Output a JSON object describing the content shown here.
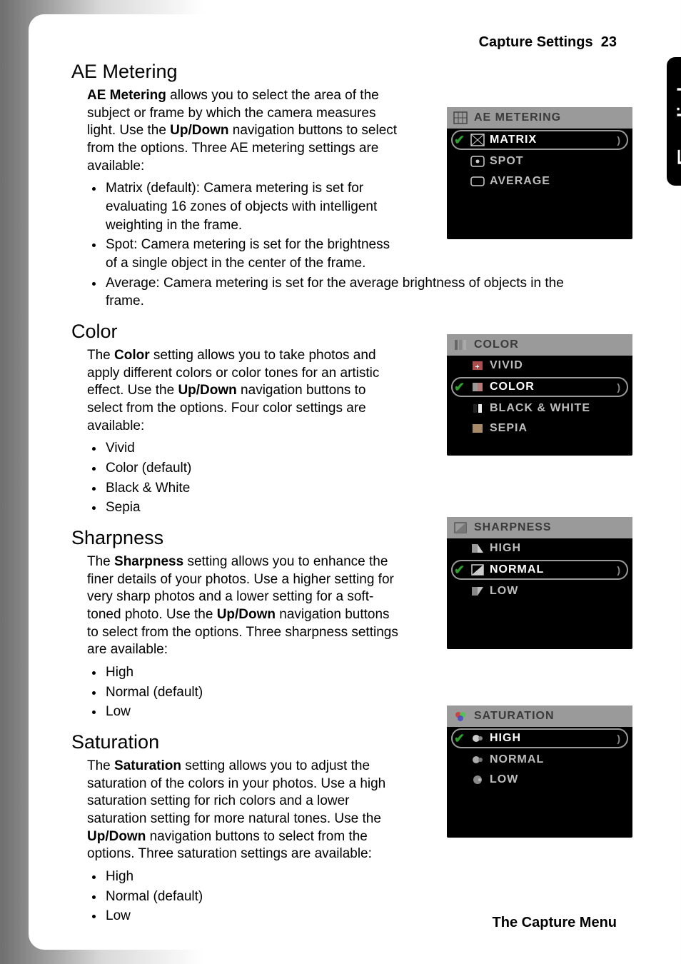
{
  "header": {
    "section": "Capture Settings",
    "page": "23"
  },
  "language_tab": "English",
  "footer": "The Capture Menu",
  "sections": {
    "ae": {
      "title": "AE Metering",
      "intro_1": "AE Metering",
      "intro_2": " allows you to select the area of the subject or frame by which the camera measures light. Use the ",
      "intro_3": "Up/Down",
      "intro_4": " navigation buttons to select from the options. Three AE metering settings are available:",
      "bullets": [
        "Matrix (default): Camera metering is set for evaluating 16 zones of objects with intelligent weighting in the frame.",
        "Spot: Camera metering is set for the brightness of a single object in the center of the frame.",
        "Average: Camera metering is set for the average brightness of objects in the frame."
      ],
      "menu": {
        "header": "AE METERING",
        "items": [
          "MATRIX",
          "SPOT",
          "AVERAGE"
        ],
        "selected": 0
      }
    },
    "color": {
      "title": "Color",
      "intro_1": "The ",
      "intro_2": "Color",
      "intro_3": " setting allows you to take photos and apply different colors or color tones for an artistic effect. Use the ",
      "intro_4": "Up/Down",
      "intro_5": " navigation buttons to select from the options. Four color settings are available:",
      "bullets": [
        "Vivid",
        "Color (default)",
        "Black & White",
        "Sepia"
      ],
      "menu": {
        "header": "COLOR",
        "items": [
          "VIVID",
          "COLOR",
          "BLACK & WHITE",
          "SEPIA"
        ],
        "selected": 1
      }
    },
    "sharp": {
      "title": "Sharpness",
      "intro_1": "The ",
      "intro_2": "Sharpness",
      "intro_3": " setting allows you to enhance the finer details of your photos. Use a higher setting for very sharp photos and a lower setting for a soft-toned photo. Use the ",
      "intro_4": "Up/Down",
      "intro_5": " navigation buttons to select from the options. Three sharpness settings are available:",
      "bullets": [
        "High",
        "Normal (default)",
        "Low"
      ],
      "menu": {
        "header": "SHARPNESS",
        "items": [
          "HIGH",
          "NORMAL",
          "LOW"
        ],
        "selected": 1
      }
    },
    "sat": {
      "title": "Saturation",
      "intro_1": "The ",
      "intro_2": "Saturation",
      "intro_3": " setting allows you to adjust the saturation of the colors in your photos. Use a high saturation setting for rich colors and a lower saturation setting for more natural tones. Use the ",
      "intro_4": "Up/Down",
      "intro_5": " navigation buttons to select from the options. Three saturation settings are available:",
      "bullets": [
        "High",
        "Normal (default)",
        "Low"
      ],
      "menu": {
        "header": "SATURATION",
        "items": [
          "HIGH",
          "NORMAL",
          "LOW"
        ],
        "selected": 0
      }
    }
  }
}
